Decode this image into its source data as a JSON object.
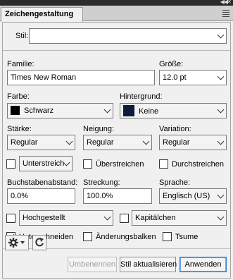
{
  "panel": {
    "tab_title": "Zeichengestaltung"
  },
  "stil": {
    "label": "Stil:",
    "value": ""
  },
  "familie": {
    "label": "Familie:",
    "value": "Times New Roman"
  },
  "groesse": {
    "label": "Größe:",
    "value": "12.0 pt"
  },
  "farbe": {
    "label": "Farbe:",
    "value": "Schwarz",
    "swatch": "#000000"
  },
  "hintergrund": {
    "label": "Hintergrund:",
    "value": "Keine",
    "swatch": "#0c1c3a"
  },
  "staerke": {
    "label": "Stärke:",
    "value": "Regular"
  },
  "neigung": {
    "label": "Neigung:",
    "value": "Regular"
  },
  "variation": {
    "label": "Variation:",
    "value": "Regular"
  },
  "unterstreichen": {
    "value": "Unterstreich",
    "checked": false
  },
  "ueberstreichen": {
    "label": "Überstreichen",
    "checked": false
  },
  "durchstreichen": {
    "label": "Durchstreichen",
    "checked": false
  },
  "buchstabenabstand": {
    "label": "Buchstabenabstand:",
    "value": "0.0%"
  },
  "streckung": {
    "label": "Streckung:",
    "value": "100.0%"
  },
  "sprache": {
    "label": "Sprache:",
    "value": "Englisch (US)"
  },
  "hochgestellt": {
    "value": "Hochgestellt",
    "checked": false
  },
  "kapitaelchen": {
    "value": "Kapitälchen",
    "checked": false
  },
  "unterschneiden": {
    "label": "Unterschneiden",
    "checked": true
  },
  "aenderungsbalken": {
    "label": "Änderungsbalken",
    "checked": false
  },
  "tsume": {
    "label": "Tsume",
    "checked": false
  },
  "buttons": {
    "umbenennen": "Umbenennen",
    "stil_aktualisieren": "Stil aktualisieren",
    "anwenden": "Anwenden"
  },
  "icons": {
    "gear": "gear-icon",
    "refresh": "refresh-icon",
    "collapse": "double-chevron-icon",
    "close": "close-icon",
    "panel_menu": "menu-icon"
  }
}
